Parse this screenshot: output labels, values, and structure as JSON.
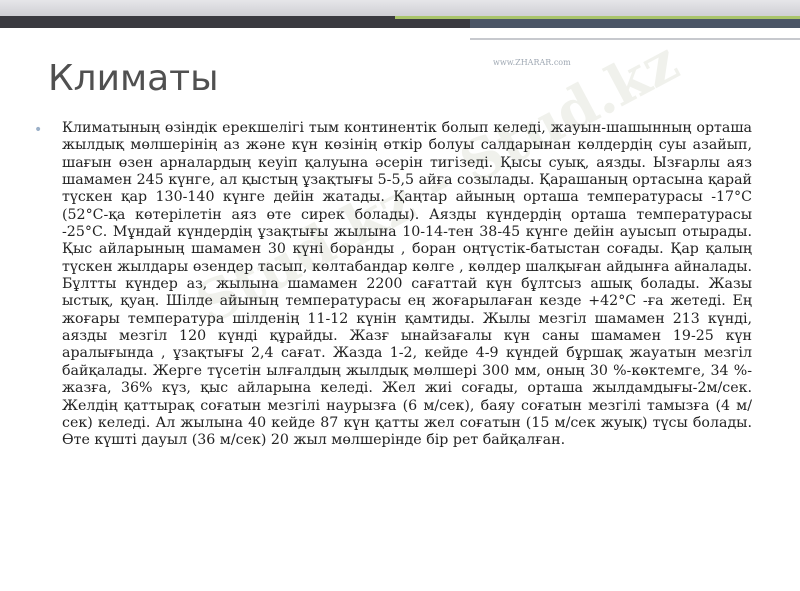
{
  "slide": {
    "title": "Климаты",
    "watermark_site": "www.ZHARAR.com",
    "watermark_text": "Stud.kz - Stud.kz",
    "bullets": [
      "Климатының өзіндік ерекшелігі тым континентік болып келеді, жауын-шашынның орташа жылдық мөлшерінің аз және күн көзінің өткір болуы салдарынан көлдердің суы азайып, шағын өзен арналардың кеуіп қалуына әсерін тигізеді. Қысы суық, аязды. Ызғарлы аяз шамамен 245 күнге, ал қыстың ұзақтығы 5-5,5 айға созылады. Қарашаның ортасына қарай түскен қар 130-140 күнге дейін жатады. Қаңтар айының орташа температурасы -17°С (52°С-қа көтерілетін аяз өте сирек болады). Аязды күндердің орташа температурасы -25°С. Мұндай күндердің ұзақтығы жылына 10-14-тен 38-45 күнге дейін ауысып отырады. Қыс айларының шамамен 30 күні боранды , боран оңтүстік-батыстан соғады. Қар қалың түскен жылдары өзендер тасып, көлтабандар көлге , көлдер шалқыған айдынға айналады. Бұлтты күндер аз, жылына шамамен 2200 сағаттай күн бұлтсыз ашық болады. Жазы ыстық, қуаң. Шілде айының температурасы ең жоғарылаған кезде +42°С -ға жетеді. Ең жоғары температура шілденің 11-12 күнін қамтиды. Жылы мезгіл шамамен 213 күнді, аязды мезгіл 120 күнді құрайды. Жазғ ынайзағалы күн саны шамамен 19-25 күн аралығында , ұзақтығы 2,4 сағат. Жазда 1-2, кейде 4-9 күндей бұршақ жауатын мезгіл байқалады. Жерге түсетін ылғалдың жылдық мөлшері 300 мм, оның 30 %-көктемге, 34 %-жазға, 36% күз, қыс айларына келеді. Жел жиі соғады, орташа жылдамдығы-2м/сек. Желдің қаттырақ соғатын мезгілі наурызға (6 м/сек), баяу соғатын мезгілі тамызға (4 м/сек) келеді. Ал жылына 40 кейде 87 күн қатты жел соғатын (15 м/сек жуық) түсы болады. Өте күшті дауыл (36 м/сек) 20 жыл мөлшерінде бір рет байқалған."
    ]
  },
  "colors": {
    "title": "#505050",
    "body_text": "#222222",
    "bullet": "#9bb0c8",
    "top_bar_dark": "#3a3a40",
    "accent_green": "#a9c46a"
  }
}
